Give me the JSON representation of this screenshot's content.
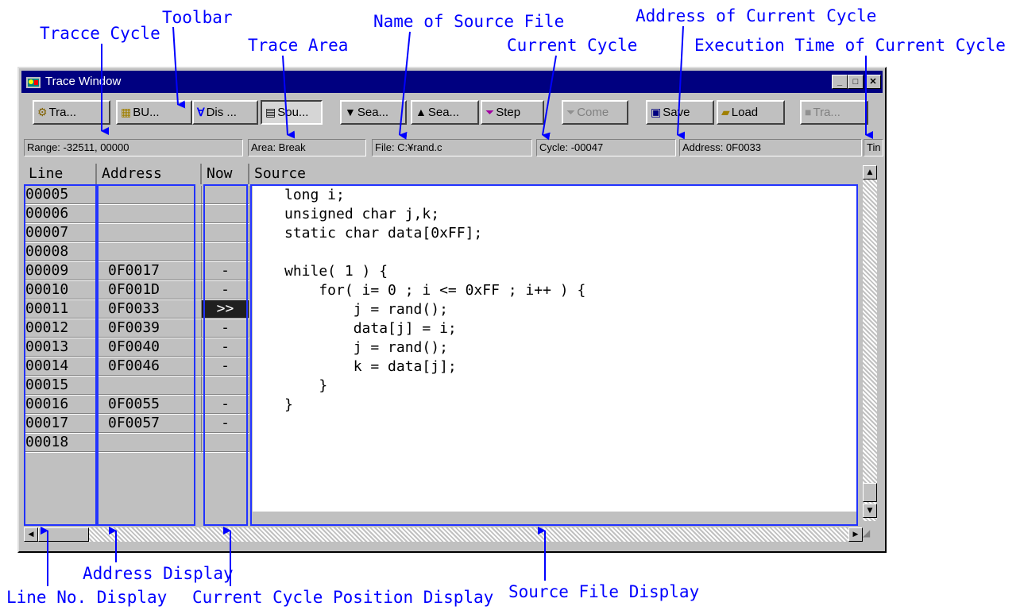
{
  "callouts": {
    "tracce_cycle": "Tracce Cycle",
    "toolbar": "Toolbar",
    "trace_area": "Trace Area",
    "name_of_source_file": "Name of Source File",
    "current_cycle": "Current Cycle",
    "address_of_current_cycle": "Address of Current Cycle",
    "execution_time": "Execution Time of Current Cycle",
    "address_display": "Address Display",
    "line_no_display": "Line No. Display",
    "current_cycle_position_display": "Current Cycle Position Display",
    "source_file_display": "Source File Display"
  },
  "colors": {
    "callout": "#0000ff",
    "titlebar": "#000080",
    "highlight": "#2233ff"
  },
  "window": {
    "title": "Trace Window",
    "icon": "trace-window-icon"
  },
  "toolbar": {
    "buttons": [
      {
        "label": "Tra...",
        "icon": "trace-icon"
      },
      {
        "label": "BU...",
        "icon": "bus-icon"
      },
      {
        "label": "Dis ...",
        "icon": "disassemble-icon"
      },
      {
        "label": "Sou...",
        "icon": "source-icon"
      },
      {
        "label": "Sea...",
        "icon": "search-down-icon"
      },
      {
        "label": "Sea...",
        "icon": "search-up-icon"
      },
      {
        "label": "Step",
        "icon": "step-icon"
      },
      {
        "label": "Come",
        "icon": "come-icon"
      },
      {
        "label": "Save",
        "icon": "save-icon"
      },
      {
        "label": "Load",
        "icon": "load-icon"
      },
      {
        "label": "Tra...",
        "icon": "trace-stop-icon"
      }
    ]
  },
  "status": {
    "range": "Range: -32511,  00000",
    "area": "Area: Break",
    "file": "File: C:¥rand.c",
    "cycle": "Cycle: -00047",
    "address": "Address: 0F0033",
    "time": "Tin"
  },
  "columns": {
    "line": "Line",
    "address": "Address",
    "now": "Now",
    "source": "Source"
  },
  "rows": [
    {
      "line": "00005",
      "address": "",
      "now": ""
    },
    {
      "line": "00006",
      "address": "",
      "now": ""
    },
    {
      "line": "00007",
      "address": "",
      "now": ""
    },
    {
      "line": "00008",
      "address": "",
      "now": ""
    },
    {
      "line": "00009",
      "address": "0F0017",
      "now": "-"
    },
    {
      "line": "00010",
      "address": "0F001D",
      "now": "-"
    },
    {
      "line": "00011",
      "address": "0F0033",
      "now": ">>"
    },
    {
      "line": "00012",
      "address": "0F0039",
      "now": "-"
    },
    {
      "line": "00013",
      "address": "0F0040",
      "now": "-"
    },
    {
      "line": "00014",
      "address": "0F0046",
      "now": "-"
    },
    {
      "line": "00015",
      "address": "",
      "now": ""
    },
    {
      "line": "00016",
      "address": "0F0055",
      "now": "-"
    },
    {
      "line": "00017",
      "address": "0F0057",
      "now": "-"
    },
    {
      "line": "00018",
      "address": "",
      "now": ""
    }
  ],
  "source_lines": [
    "long i;",
    "unsigned char j,k;",
    "static char data[0xFF];",
    "",
    "while( 1 ) {",
    "    for( i= 0 ; i <= 0xFF ; i++ ) {",
    "        j = rand();",
    "        data[j] = i;",
    "        j = rand();",
    "        k = data[j];",
    "    }",
    "}"
  ]
}
